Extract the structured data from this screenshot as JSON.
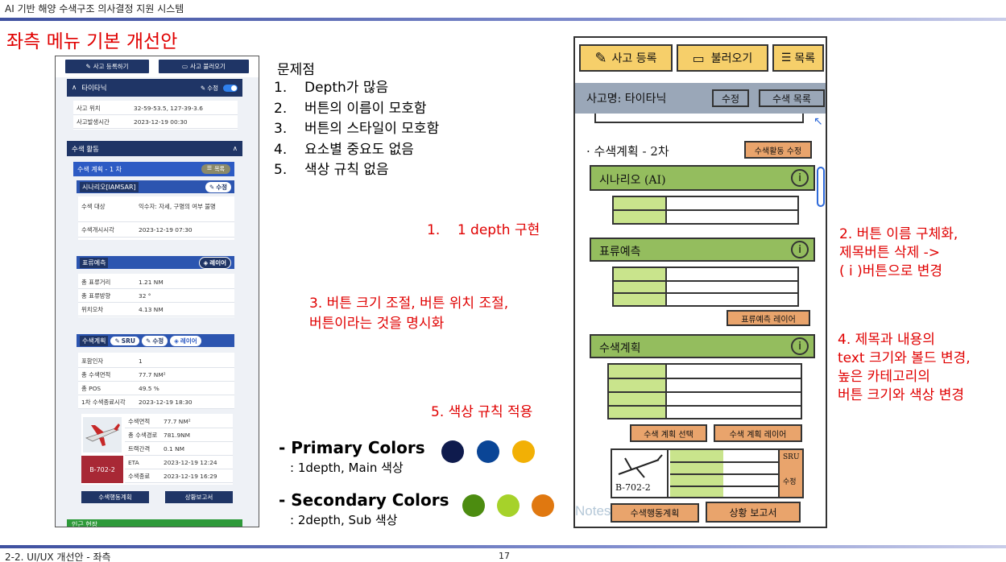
{
  "header": {
    "title": "AI 기반 해양 수색구조 의사결정 지원 시스템",
    "slide_title": "좌측 메뉴 기본 개선안"
  },
  "panel": {
    "register_btn": "사고 등록하기",
    "load_btn": "사고 불러오기",
    "incident_name": "타이타닉",
    "edit_label": "수정",
    "info_rows": [
      {
        "k": "사고 위치",
        "v": "32-59-53.5, 127-39-3.6"
      },
      {
        "k": "사고발생시간",
        "v": "2023-12-19 00:30"
      }
    ],
    "search_activity": "수색 활동",
    "search_plan_1": "수색 계획 - 1 차",
    "list_btn": "목록",
    "scenario": "시나리오[IAMSAR]",
    "scenario_edit": "수정",
    "scenario_rows": [
      {
        "k": "수색 대상",
        "v": "익수자: 자세, 구명의 여부 불명"
      },
      {
        "k": "수색개시시각",
        "v": "2023-12-19 07:30"
      }
    ],
    "drift": "표류예측",
    "layer": "레이어",
    "drift_rows": [
      {
        "k": "총 표류거리",
        "v": "1.21 NM"
      },
      {
        "k": "총 표류방향",
        "v": "32 °"
      },
      {
        "k": "위치오차",
        "v": "4.13 NM"
      }
    ],
    "plan": "수색계획",
    "sru": "SRU",
    "plan_edit": "수정",
    "plan_layer": "레이어",
    "plan_rows": [
      {
        "k": "포함인자",
        "v": "1"
      },
      {
        "k": "총 수색면적",
        "v": "77.7 NM²"
      },
      {
        "k": "총 POS",
        "v": "49.5 %"
      },
      {
        "k": "1차 수색종료시각",
        "v": "2023-12-19 18:30"
      }
    ],
    "asset_rows": [
      {
        "k": "수색면적",
        "v": "77.7 NM²"
      },
      {
        "k": "총 수색경로",
        "v": "781.9NM"
      },
      {
        "k": "트랙간격",
        "v": "0.1 NM"
      },
      {
        "k": "ETA",
        "v": "2023-12-19 12:24"
      },
      {
        "k": "수색종료",
        "v": "2023-12-19 16:29"
      }
    ],
    "asset_id": "B-702-2",
    "action_plan_btn": "수색행동계획",
    "report_btn": "상황보고서",
    "bottom_cut": "인근 현장"
  },
  "problems": {
    "title": "문제점",
    "items": [
      {
        "n": "1.",
        "t": "Depth가 많음"
      },
      {
        "n": "2.",
        "t": "버튼의 이름이 모호함"
      },
      {
        "n": "3.",
        "t": "버튼의 스타일이 모호함"
      },
      {
        "n": "4.",
        "t": "요소별 중요도 없음"
      },
      {
        "n": "5.",
        "t": "색상 규칙 없음"
      }
    ]
  },
  "improvements": {
    "i1": "1.    1 depth 구현",
    "i3_line1": "3. 버튼 크기 조절, 버튼 위치 조절,",
    "i3_line2": "버튼이라는 것을 명시화",
    "i5": "5. 색상 규칙 적용",
    "i2_line1": "2. 버튼 이름 구체화,",
    "i2_line2": "제목버튼 삭제 ->",
    "i2_line3": "( i )버튼으로 변경",
    "i4_line1": "4. 제목과 내용의",
    "i4_line2": "text 크기와 볼드 변경,",
    "i4_line3": "높은 카테고리의",
    "i4_line4": "버튼 크기와 색상 변경"
  },
  "colors": {
    "primary_label": "- Primary Colors",
    "primary_sub": ": 1depth, Main 색상",
    "primary": [
      "#0f1b4d",
      "#0a4596",
      "#f2b005"
    ],
    "secondary_label": "- Secondary Colors",
    "secondary_sub": ": 2depth, Sub 색상",
    "secondary": [
      "#4c8c10",
      "#a6d22a",
      "#e07810"
    ]
  },
  "sketch": {
    "btn_register": "사고 등록",
    "btn_load": "불러오기",
    "btn_list": "목록",
    "incident": "사고명: 타이타닉",
    "edit": "수정",
    "search_list": "수색 목록",
    "plan2": "· 수색계획 - 2차",
    "plan_edit": "수색활동 수정",
    "scenario": "시나리오 (AI)",
    "drift": "표류예측",
    "drift_layer": "표류예측 레이어",
    "plan": "수색계획",
    "plan_select": "수색 계획 선택",
    "plan_layer": "수색 계획 레이어",
    "sru": "SRU",
    "sru_edit": "수정",
    "asset": "B-702-2",
    "action": "수색행동계획",
    "report": "상황 보고서",
    "watermark": "Notes"
  },
  "footer": {
    "left": "2-2. UI/UX 개선안 - 좌측",
    "page": "17"
  }
}
